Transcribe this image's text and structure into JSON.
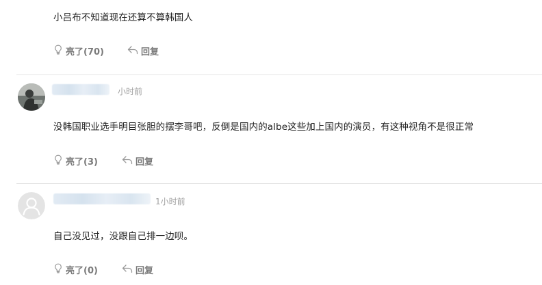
{
  "comments": [
    {
      "text": "小吕布不知道现在还算不算韩国人",
      "like_label": "亮了(70)",
      "reply_label": "回复",
      "avatar_icon": "user-photo-avatar",
      "time": ""
    },
    {
      "time": "小时前",
      "text": "没韩国职业选手明目张胆的摆李哥吧，反倒是国内的albe这些加上国内的演员，有这种视角不是很正常",
      "like_label": "亮了(3)",
      "reply_label": "回复",
      "avatar_icon": "user-photo-avatar"
    },
    {
      "time": "1小时前",
      "text": "自己没见过，没跟自己排一边呗。",
      "like_label": "亮了(0)",
      "reply_label": "回复",
      "avatar_icon": "default-user-avatar"
    }
  ],
  "colors": {
    "text": "#222222",
    "meta": "#a0a0a0",
    "action": "#7a7a7a",
    "divider": "#e6e6e6"
  }
}
